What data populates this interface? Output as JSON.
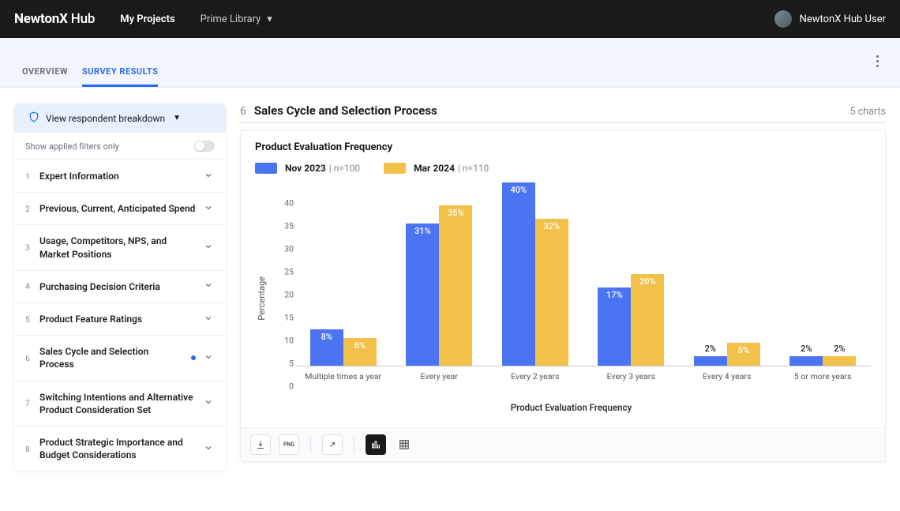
{
  "topbar": {
    "brand_bold": "NewtonX",
    "brand_light": " Hub",
    "nav_myprojects": "My Projects",
    "library": "Prime Library",
    "user": "NewtonX Hub User"
  },
  "tabs": {
    "overview": "OVERVIEW",
    "survey": "SURVEY RESULTS"
  },
  "sidebar": {
    "respondent": "View respondent breakdown",
    "filters_label": "Show applied filters only",
    "items": [
      {
        "num": "1",
        "label": "Expert Information"
      },
      {
        "num": "2",
        "label": "Previous, Current, Anticipated Spend"
      },
      {
        "num": "3",
        "label": "Usage, Competitors, NPS, and Market Positions"
      },
      {
        "num": "4",
        "label": "Purchasing Decision Criteria"
      },
      {
        "num": "5",
        "label": "Product Feature Ratings"
      },
      {
        "num": "6",
        "label": "Sales Cycle and Selection Process"
      },
      {
        "num": "7",
        "label": "Switching Intentions and Alternative Product Consideration Set"
      },
      {
        "num": "8",
        "label": "Product Strategic Importance and Budget Considerations"
      }
    ]
  },
  "section": {
    "num": "6",
    "title": "Sales Cycle and Selection Process",
    "count": "5 charts"
  },
  "chart": {
    "title": "Product Evaluation Frequency",
    "legend_a": "Nov 2023",
    "legend_a_sub": "| n=100",
    "legend_b": "Mar 2024",
    "legend_b_sub": "| n=110",
    "xlabel": "Product Evaluation Frequency",
    "ylabel": "Percentage"
  },
  "chart_data": {
    "type": "bar",
    "title": "Product Evaluation Frequency",
    "xlabel": "Product Evaluation Frequency",
    "ylabel": "Percentage",
    "ylim": [
      0,
      40
    ],
    "yticks": [
      0,
      5,
      10,
      15,
      20,
      25,
      30,
      35,
      40
    ],
    "categories": [
      "Multiple times a year",
      "Every year",
      "Every 2 years",
      "Every 3 years",
      "Every 4 years",
      "5 or more years"
    ],
    "series": [
      {
        "name": "Nov 2023",
        "n": 100,
        "color": "#4a74f2",
        "values": [
          8,
          31,
          40,
          17,
          2,
          2
        ]
      },
      {
        "name": "Mar 2024",
        "n": 110,
        "color": "#f2c14a",
        "values": [
          6,
          35,
          32,
          20,
          5,
          2
        ]
      }
    ]
  },
  "colors": {
    "blue": "#4a74f2",
    "yellow": "#f2c14a"
  }
}
